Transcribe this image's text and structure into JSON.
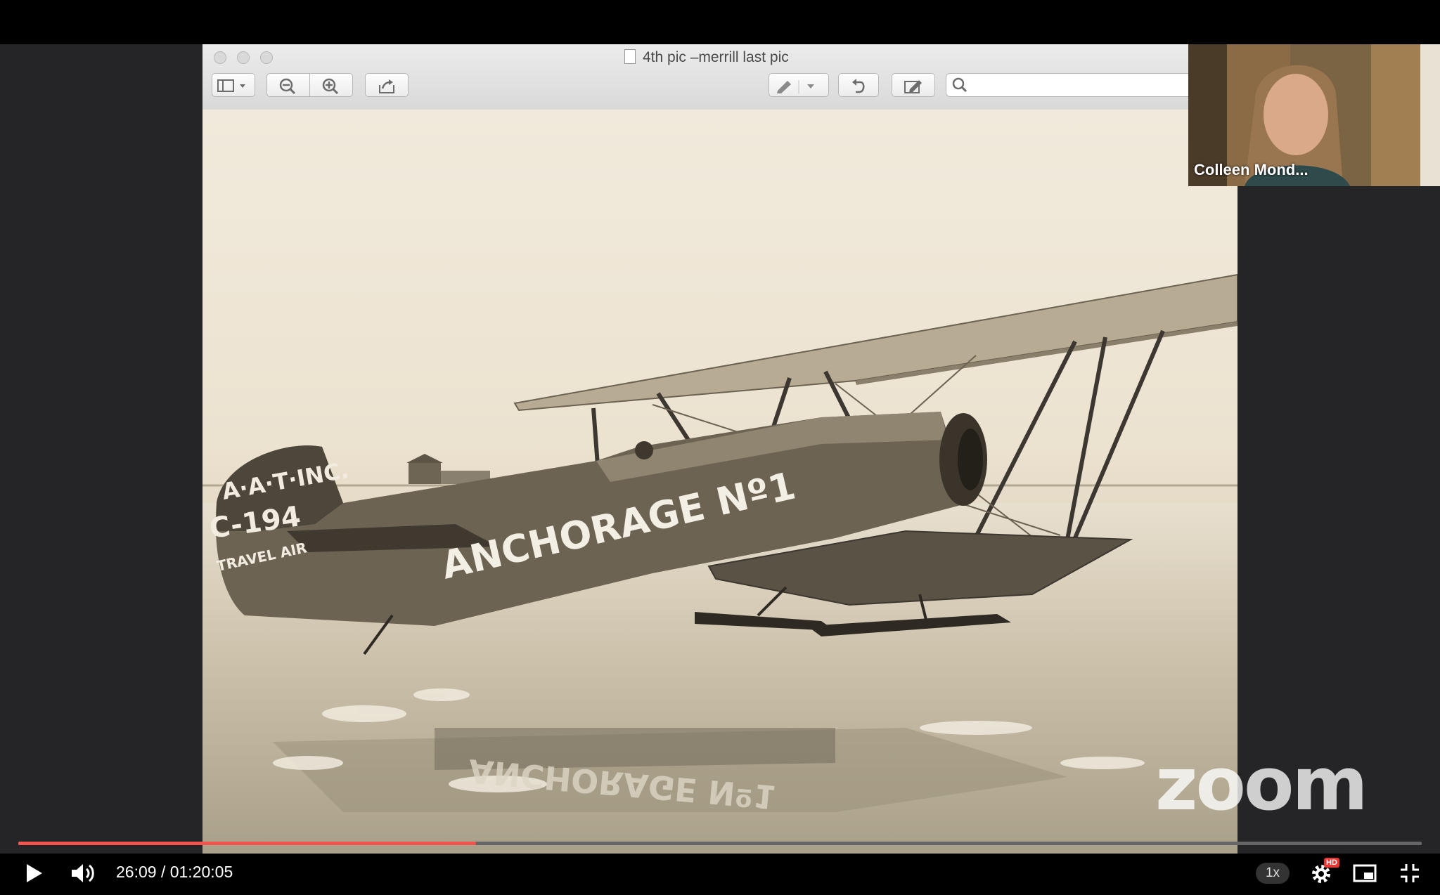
{
  "window": {
    "title": "4th pic –merrill last pic"
  },
  "photo": {
    "tail_text_1": "A·A·T·INC.",
    "tail_text_2": "C-194",
    "tail_text_3": "TRAVEL AIR",
    "fuselage_text": "ANCHORAGE Nº1",
    "reflection_text": "ANCHORAGE Nº1"
  },
  "participant": {
    "name": "Colleen Mond..."
  },
  "watermark": {
    "logo_text": "zoom"
  },
  "player": {
    "time": "26:09 / 01:20:05",
    "progress_fraction": 0.326,
    "speed": "1x",
    "quality_badge": "HD"
  }
}
